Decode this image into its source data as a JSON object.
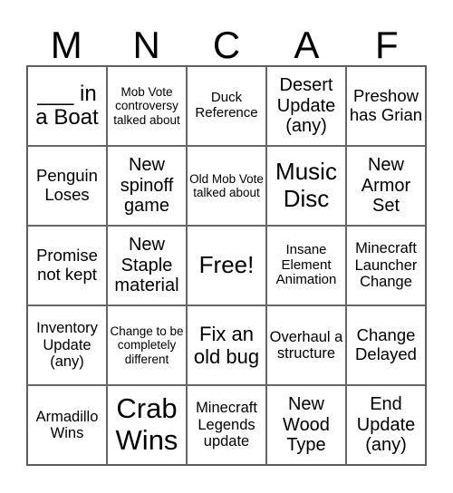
{
  "header": [
    "M",
    "N",
    "C",
    "A",
    "F"
  ],
  "cells": [
    "___ in a Boat",
    "Mob Vote controversy talked about",
    "Duck Reference",
    "Desert Update (any)",
    "Preshow has Grian",
    "Penguin Loses",
    "New spinoff game",
    "Old Mob Vote talked about",
    "Music Disc",
    "New Armor Set",
    "Promise not kept",
    "New Staple material",
    "Free!",
    "Insane Element Animation",
    "Minecraft Launcher Change",
    "Inventory Update (any)",
    "Change to be completely different",
    "Fix an old bug",
    "Overhaul a structure",
    "Change Delayed",
    "Armadillo Wins",
    "Crab Wins",
    "Minecraft Legends update",
    "New Wood Type",
    "End Update (any)"
  ]
}
